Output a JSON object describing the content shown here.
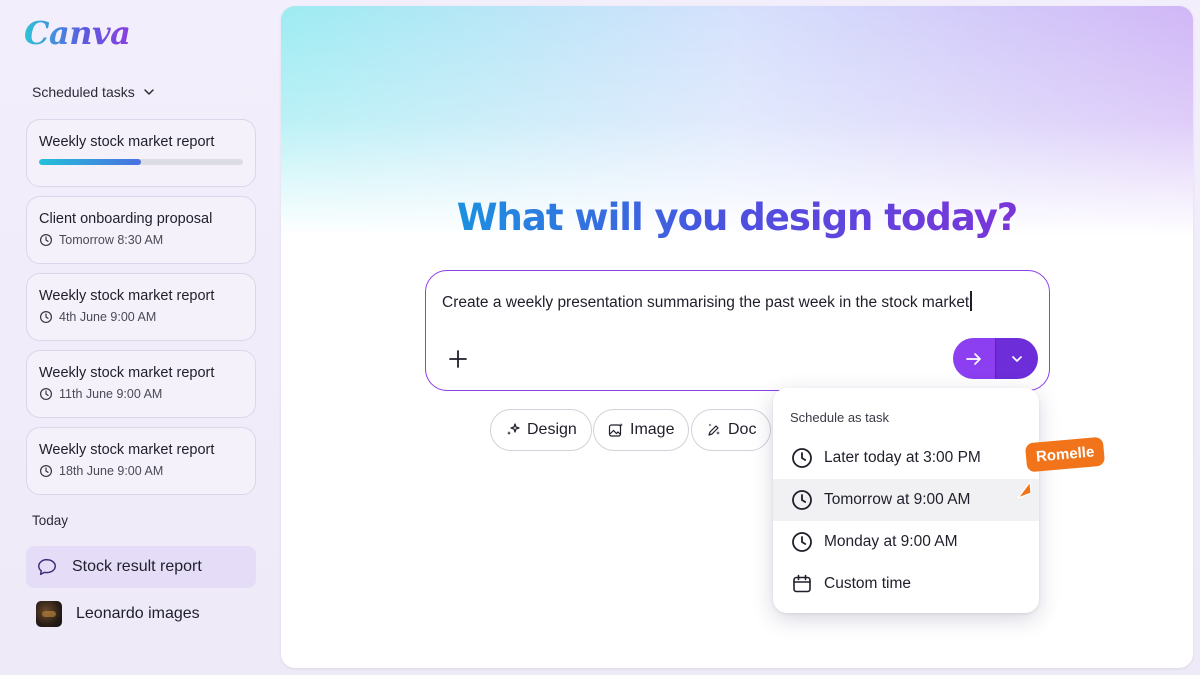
{
  "app": {
    "logo": "Canva"
  },
  "sidebar": {
    "scheduled_header": "Scheduled tasks",
    "tasks": [
      {
        "title": "Weekly stock market report",
        "progress": 0.5
      },
      {
        "title": "Client onboarding proposal",
        "time": "Tomorrow 8:30 AM"
      },
      {
        "title": "Weekly stock market report",
        "time": "4th June 9:00 AM"
      },
      {
        "title": "Weekly stock market report",
        "time": "11th June 9:00 AM"
      },
      {
        "title": "Weekly stock market report",
        "time": "18th June 9:00 AM"
      }
    ],
    "today_label": "Today",
    "recent": [
      {
        "label": "Stock result report",
        "icon": "chat-bubble-icon",
        "active": true
      },
      {
        "label": "Leonardo images",
        "icon": "image-thumbnail"
      }
    ]
  },
  "main": {
    "headline": "What will you design today?",
    "prompt_text": "Create a weekly presentation summarising the past week in the stock market",
    "chips": [
      {
        "label": "Design",
        "icon": "sparkle-icon"
      },
      {
        "label": "Image",
        "icon": "image-sparkle-icon"
      },
      {
        "label": "Doc",
        "icon": "pen-sparkle-icon"
      }
    ]
  },
  "dropdown": {
    "title": "Schedule as task",
    "items": [
      {
        "label": "Later today at 3:00 PM",
        "icon": "clock-icon"
      },
      {
        "label": "Tomorrow at 9:00 AM",
        "icon": "clock-icon",
        "hover": true
      },
      {
        "label": "Monday at 9:00 AM",
        "icon": "clock-icon"
      },
      {
        "label": "Custom time",
        "icon": "calendar-icon"
      }
    ]
  },
  "collaborator": {
    "name": "Romelle",
    "color": "#f2741a"
  },
  "colors": {
    "accent": "#8b3ff0",
    "accent_dark": "#6d2dd8",
    "active_item_bg": "#e5ddf8"
  }
}
